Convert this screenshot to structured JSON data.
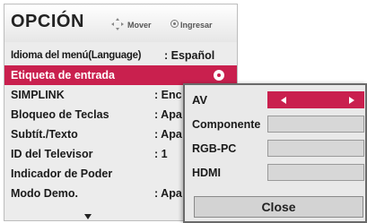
{
  "menu": {
    "title": "OPCIÓN",
    "hints": {
      "move_label": "Mover",
      "enter_label": "Ingresar"
    },
    "items": [
      {
        "label": "Idioma del menú(Language)",
        "value": ": Español"
      },
      {
        "label": "Etiqueta de entrada",
        "value": ""
      },
      {
        "label": "SIMPLINK",
        "value": ": Enc"
      },
      {
        "label": "Bloqueo de Teclas",
        "value": ": Apa"
      },
      {
        "label": "Subtít./Texto",
        "value": ": Apa"
      },
      {
        "label": "ID del Televisor",
        "value": ": 1"
      },
      {
        "label": "Indicador de Poder",
        "value": ""
      },
      {
        "label": "Modo Demo.",
        "value": ": Apa"
      }
    ],
    "selected_index": 1
  },
  "popup": {
    "rows": [
      {
        "label": "AV",
        "value": ""
      },
      {
        "label": "Componente",
        "value": ""
      },
      {
        "label": "RGB-PC",
        "value": ""
      },
      {
        "label": "HDMI",
        "value": ""
      }
    ],
    "close_label": "Close"
  },
  "colors": {
    "highlight": "#c9204e",
    "panel": "#ececec",
    "field": "#d7d7d7"
  }
}
